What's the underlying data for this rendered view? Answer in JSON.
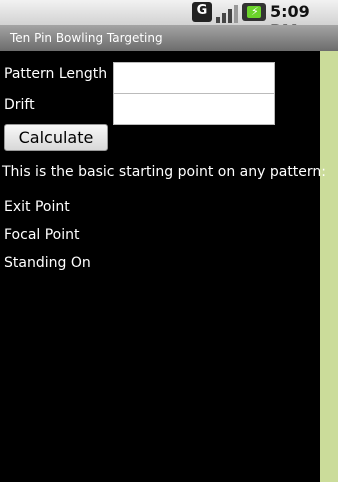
{
  "status_bar": {
    "carrier_icon_letter": "G",
    "time": "5:09 PM",
    "icons": [
      "g-notification-icon",
      "signal-bars-icon",
      "battery-charging-icon"
    ]
  },
  "app": {
    "title": "Ten Pin Bowling Targeting"
  },
  "form": {
    "pattern_length_label": "Pattern Length",
    "pattern_length_value": "",
    "drift_label": "Drift",
    "drift_value": "",
    "calculate_label": "Calculate"
  },
  "results": {
    "intro": "This is the basic starting point on any pattern:",
    "exit_point_label": "Exit Point",
    "focal_point_label": "Focal Point",
    "standing_on_label": "Standing On"
  },
  "colors": {
    "background": "#000000",
    "scrollbar": "#cbdc9a",
    "battery": "#6bd42b"
  }
}
